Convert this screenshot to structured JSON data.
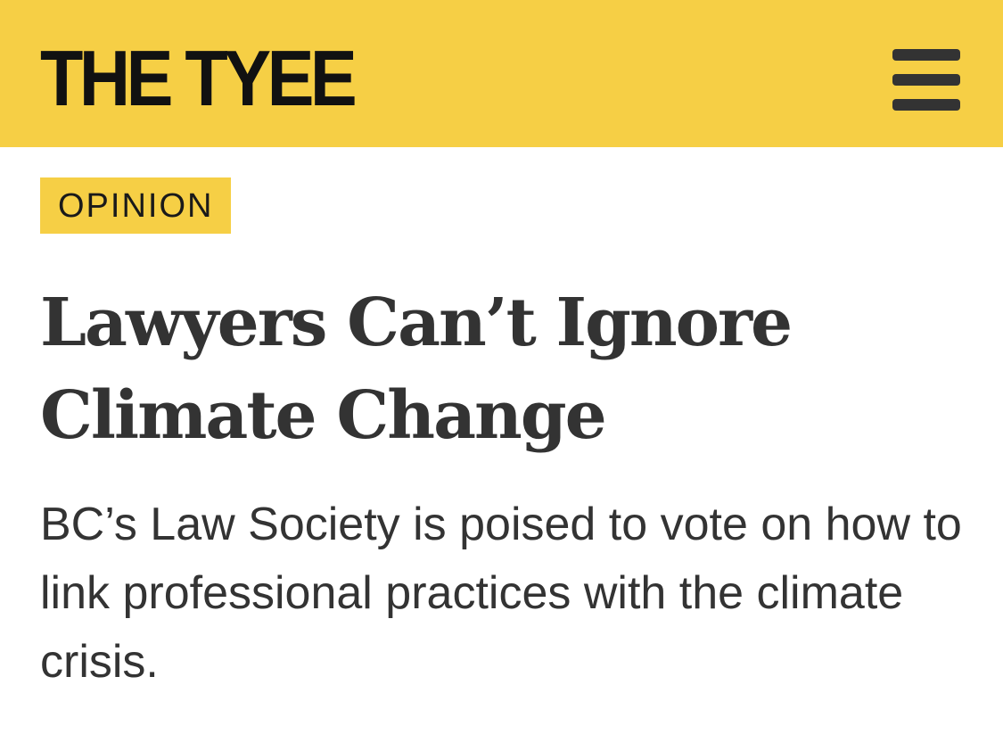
{
  "colors": {
    "brand": "#f6cf45",
    "text": "#333333"
  },
  "header": {
    "logo_text": "THE TYEE",
    "menu_icon": "hamburger-menu-icon"
  },
  "article": {
    "section_label": "OPINION",
    "headline": "Lawyers Can’t Ignore Climate Change",
    "dek": "BC’s Law Society is poised to vote on how to link professional practices with the climate crisis."
  }
}
